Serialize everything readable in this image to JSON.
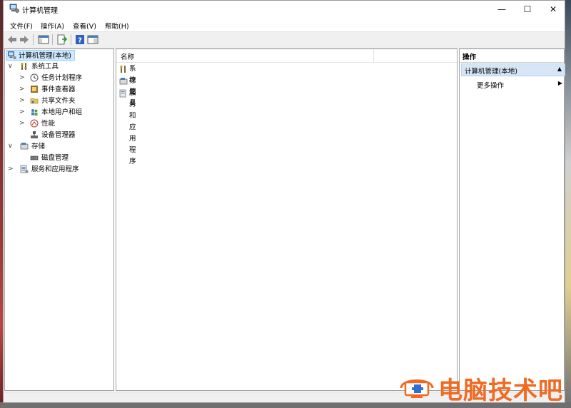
{
  "window": {
    "title": "计算机管理",
    "controls": {
      "minimize": "—",
      "maximize": "☐",
      "close": "✕"
    }
  },
  "menubar": [
    {
      "label": "文件(F)"
    },
    {
      "label": "操作(A)"
    },
    {
      "label": "查看(V)"
    },
    {
      "label": "帮助(H)"
    }
  ],
  "toolbar": {
    "buttons": [
      "back-icon",
      "forward-icon",
      "show-hide-console-tree-icon",
      "export-list-icon",
      "help-icon",
      "show-hide-action-pane-icon"
    ]
  },
  "tree": {
    "root": "计算机管理(本地)",
    "items": [
      {
        "label": "系统工具",
        "level": 1,
        "expander": "∨"
      },
      {
        "label": "任务计划程序",
        "level": 2,
        "expander": ">"
      },
      {
        "label": "事件查看器",
        "level": 2,
        "expander": ">"
      },
      {
        "label": "共享文件夹",
        "level": 2,
        "expander": ">"
      },
      {
        "label": "本地用户和组",
        "level": 2,
        "expander": ">"
      },
      {
        "label": "性能",
        "level": 2,
        "expander": ">"
      },
      {
        "label": "设备管理器",
        "level": 2,
        "expander": ""
      },
      {
        "label": "存储",
        "level": 1,
        "expander": "∨"
      },
      {
        "label": "磁盘管理",
        "level": 2,
        "expander": ""
      },
      {
        "label": "服务和应用程序",
        "level": 1,
        "expander": ">"
      }
    ]
  },
  "content": {
    "column_header": "名称",
    "items": [
      {
        "label": "系统工具"
      },
      {
        "label": "存储"
      },
      {
        "label": "服务和应用程序"
      }
    ]
  },
  "actions": {
    "header": "操作",
    "section": "计算机管理(本地)",
    "section_arrow": "▲",
    "more": "更多操作",
    "more_arrow": "▶"
  },
  "watermark": {
    "text": "电脑技术吧"
  },
  "colors": {
    "selection": "#cde8ff",
    "action_section": "#d6e6f6",
    "watermark": "#f06a22"
  }
}
